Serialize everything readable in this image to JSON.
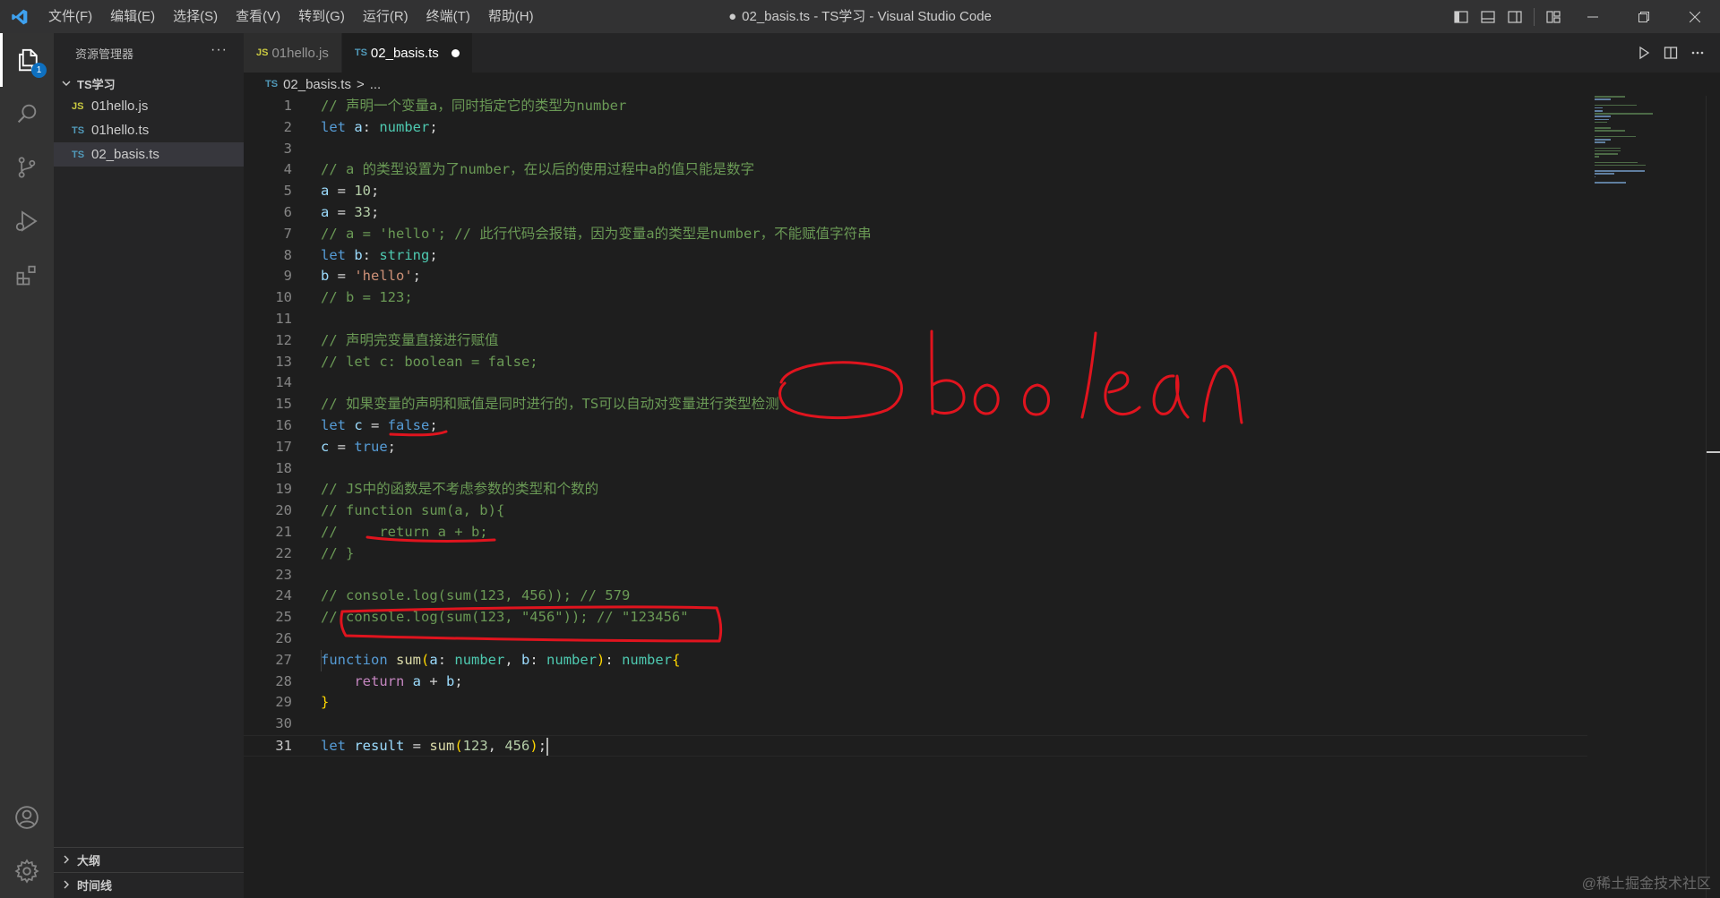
{
  "window": {
    "title": "02_basis.ts - TS学习 - Visual Studio Code",
    "modified_dot": "●"
  },
  "menu": [
    "文件(F)",
    "编辑(E)",
    "选择(S)",
    "查看(V)",
    "转到(G)",
    "运行(R)",
    "终端(T)",
    "帮助(H)"
  ],
  "activity_bar": {
    "items": [
      "explorer-icon",
      "search-icon",
      "source-control-icon",
      "run-debug-icon",
      "extensions-icon"
    ],
    "bottom": [
      "account-icon",
      "settings-gear-icon"
    ],
    "explorer_badge": "1",
    "badge_color": "#0e70c0"
  },
  "sidebar": {
    "title": "资源管理器",
    "more": "···",
    "folder": "TS学习",
    "files": [
      {
        "type": "JS",
        "name": "01hello.js"
      },
      {
        "type": "TS",
        "name": "01hello.ts"
      },
      {
        "type": "TS",
        "name": "02_basis.ts"
      }
    ],
    "outline_label": "大纲",
    "timeline_label": "时间线"
  },
  "tabs": [
    {
      "type": "JS",
      "label": "01hello.js",
      "active": false
    },
    {
      "type": "TS",
      "label": "02_basis.ts",
      "active": true,
      "unsaved": true
    }
  ],
  "breadcrumb": {
    "file_type": "TS",
    "file": "02_basis.ts",
    "separator": ">",
    "rest": "..."
  },
  "editor": {
    "current_line": 31,
    "line_numbers": [
      "1",
      "2",
      "3",
      "4",
      "5",
      "6",
      "7",
      "8",
      "9",
      "10",
      "11",
      "12",
      "13",
      "14",
      "15",
      "16",
      "17",
      "18",
      "19",
      "20",
      "21",
      "22",
      "23",
      "24",
      "25",
      "26",
      "27",
      "28",
      "29",
      "30",
      "31"
    ],
    "lines": [
      [
        [
          "c-com",
          "// 声明一个变量a，同时指定它的类型为number"
        ]
      ],
      [
        [
          "c-kw",
          "let "
        ],
        [
          "c-var",
          "a"
        ],
        [
          "c-pl",
          ": "
        ],
        [
          "c-type",
          "number"
        ],
        [
          "c-pl",
          ";"
        ]
      ],
      [],
      [
        [
          "c-com",
          "// a 的类型设置为了number，在以后的使用过程中a的值只能是数字"
        ]
      ],
      [
        [
          "c-var",
          "a"
        ],
        [
          "c-pl",
          " = "
        ],
        [
          "c-num",
          "10"
        ],
        [
          "c-pl",
          ";"
        ]
      ],
      [
        [
          "c-var",
          "a"
        ],
        [
          "c-pl",
          " = "
        ],
        [
          "c-num",
          "33"
        ],
        [
          "c-pl",
          ";"
        ]
      ],
      [
        [
          "c-com",
          "// a = 'hello'; // 此行代码会报错，因为变量a的类型是number，不能赋值字符串"
        ]
      ],
      [
        [
          "c-kw",
          "let "
        ],
        [
          "c-var",
          "b"
        ],
        [
          "c-pl",
          ": "
        ],
        [
          "c-type",
          "string"
        ],
        [
          "c-pl",
          ";"
        ]
      ],
      [
        [
          "c-var",
          "b"
        ],
        [
          "c-pl",
          " = "
        ],
        [
          "c-str",
          "'hello'"
        ],
        [
          "c-pl",
          ";"
        ]
      ],
      [
        [
          "c-com",
          "// b = 123;"
        ]
      ],
      [],
      [
        [
          "c-com",
          "// 声明完变量直接进行赋值"
        ]
      ],
      [
        [
          "c-com",
          "// let c: boolean = false;"
        ]
      ],
      [],
      [
        [
          "c-com",
          "// 如果变量的声明和赋值是同时进行的，TS可以自动对变量进行类型检测"
        ]
      ],
      [
        [
          "c-kw",
          "let "
        ],
        [
          "c-var",
          "c"
        ],
        [
          "c-pl",
          " = "
        ],
        [
          "c-kw",
          "false"
        ],
        [
          "c-pl",
          ";"
        ]
      ],
      [
        [
          "c-var",
          "c"
        ],
        [
          "c-pl",
          " = "
        ],
        [
          "c-kw",
          "true"
        ],
        [
          "c-pl",
          ";"
        ]
      ],
      [],
      [
        [
          "c-com",
          "// JS中的函数是不考虑参数的类型和个数的"
        ]
      ],
      [
        [
          "c-com",
          "// function sum(a, b){"
        ]
      ],
      [
        [
          "c-com",
          "//     return a + b;"
        ]
      ],
      [
        [
          "c-com",
          "// }"
        ]
      ],
      [],
      [
        [
          "c-com",
          "// console.log(sum(123, 456)); // 579"
        ]
      ],
      [
        [
          "c-com",
          "// console.log(sum(123, \"456\")); // \"123456\""
        ]
      ],
      [],
      [
        [
          "c-kw",
          "function "
        ],
        [
          "c-fn",
          "sum"
        ],
        [
          "c-br",
          "("
        ],
        [
          "c-var",
          "a"
        ],
        [
          "c-pl",
          ": "
        ],
        [
          "c-type",
          "number"
        ],
        [
          "c-pl",
          ", "
        ],
        [
          "c-var",
          "b"
        ],
        [
          "c-pl",
          ": "
        ],
        [
          "c-type",
          "number"
        ],
        [
          "c-br",
          ")"
        ],
        [
          "c-pl",
          ": "
        ],
        [
          "c-type",
          "number"
        ],
        [
          "c-br",
          "{"
        ]
      ],
      [
        [
          "c-pl",
          "    "
        ],
        [
          "c-ctl",
          "return "
        ],
        [
          "c-var",
          "a"
        ],
        [
          "c-pl",
          " + "
        ],
        [
          "c-var",
          "b"
        ],
        [
          "c-pl",
          ";"
        ]
      ],
      [
        [
          "c-br",
          "}"
        ]
      ],
      [],
      [
        [
          "c-kw",
          "let "
        ],
        [
          "c-var",
          "result"
        ],
        [
          "c-pl",
          " = "
        ],
        [
          "c-fn",
          "sum"
        ],
        [
          "c-br",
          "("
        ],
        [
          "c-num",
          "123"
        ],
        [
          "c-pl",
          ", "
        ],
        [
          "c-num",
          "456"
        ],
        [
          "c-br",
          ")"
        ],
        [
          "c-pl",
          ";"
        ]
      ]
    ]
  },
  "annotation": {
    "handwritten_text": "boolean",
    "ink_color": "#e0141e"
  },
  "watermark": "@稀土掘金技术社区"
}
